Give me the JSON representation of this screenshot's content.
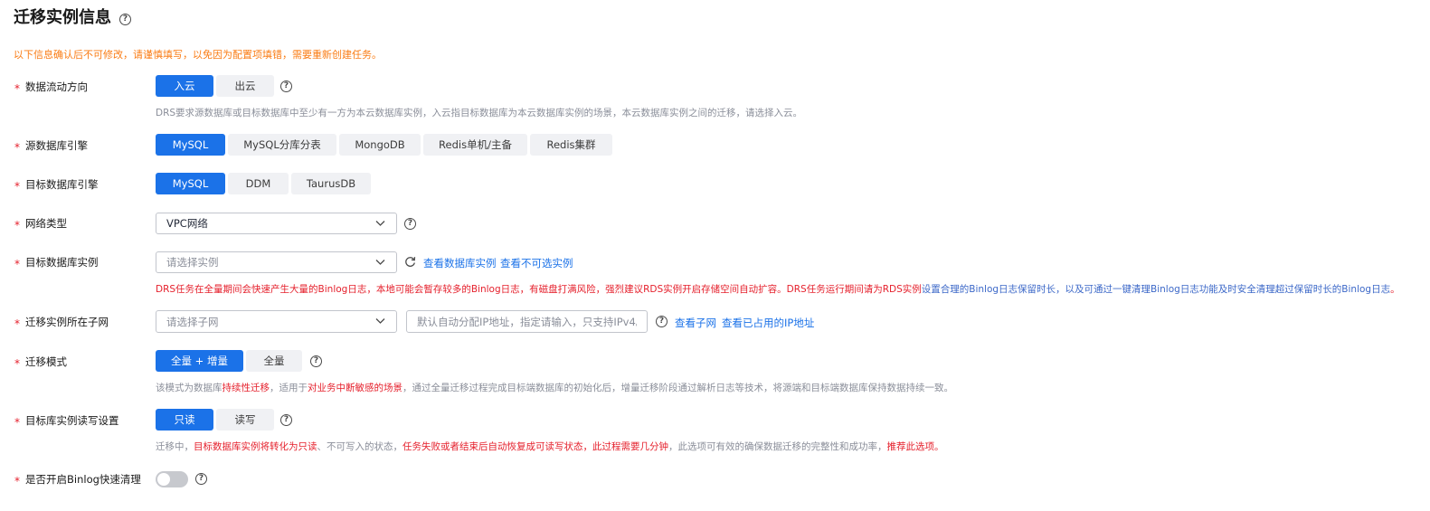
{
  "page": {
    "title": "迁移实例信息",
    "warning": "以下信息确认后不可修改，请谨慎填写，以免因为配置项填错，需要重新创建任务。"
  },
  "fields": {
    "flow": {
      "label": "数据流动方向",
      "options": [
        "入云",
        "出云"
      ],
      "selected": "入云",
      "hint": "DRS要求源数据库或目标数据库中至少有一方为本云数据库实例，入云指目标数据库为本云数据库实例的场景，本云数据库实例之间的迁移，请选择入云。"
    },
    "source_engine": {
      "label": "源数据库引擎",
      "options": [
        "MySQL",
        "MySQL分库分表",
        "MongoDB",
        "Redis单机/主备",
        "Redis集群"
      ],
      "selected": "MySQL"
    },
    "target_engine": {
      "label": "目标数据库引擎",
      "options": [
        "MySQL",
        "DDM",
        "TaurusDB"
      ],
      "selected": "MySQL"
    },
    "network": {
      "label": "网络类型",
      "value": "VPC网络"
    },
    "target_instance": {
      "label": "目标数据库实例",
      "placeholder": "请选择实例",
      "link_view": "查看数据库实例",
      "link_unavailable": "查看不可选实例",
      "warning_red_1": "DRS任务在全量期间会快速产生大量的Binlog日志，本地可能会暂存较多的Binlog日志，有磁盘打满风险，强烈建议RDS实例开启存储空间自动扩容。DRS任务运行期间请为RDS实例",
      "warning_blue": "设置合理的Binlog日志保留时长，以及可通过一键清理Binlog日志功能及时安全清理超过保留时长的Binlog日志",
      "warning_red_2": "。"
    },
    "subnet": {
      "label": "迁移实例所在子网",
      "placeholder": "请选择子网",
      "ip_placeholder": "默认自动分配IP地址，指定请输入，只支持IPv4。",
      "link_subnet": "查看子网",
      "link_used_ip": "查看已占用的IP地址"
    },
    "mode": {
      "label": "迁移模式",
      "options": [
        "全量 + 增量",
        "全量"
      ],
      "selected": "全量 + 增量",
      "hint_1": "该模式为数据库",
      "hint_2": "持续性迁移",
      "hint_3": "，适用于",
      "hint_4": "对业务中断敏感的场景",
      "hint_5": "，通过全量迁移过程完成目标端数据库的初始化后，增量迁移阶段通过解析日志等技术，将源端和目标端数据库保持数据持续一致。"
    },
    "readwrite": {
      "label": "目标库实例读写设置",
      "options": [
        "只读",
        "读写"
      ],
      "selected": "只读",
      "hint_1": "迁移中，",
      "hint_2": "目标数据库实例将转化为只读",
      "hint_3": "、不可写入的状态，",
      "hint_4": "任务失败或者结束后自动恢复成可读写状态，此过程需要几分钟",
      "hint_5": "，此选项可有效的确保数据迁移的完整性和成功率，",
      "hint_6": "推荐此选项。"
    },
    "binlog": {
      "label": "是否开启Binlog快速清理",
      "enabled": false
    }
  },
  "colors": {
    "primary": "#1b72e8",
    "required": "#e5202c",
    "warning_orange": "#fa7c14",
    "hint_gray": "#8a8e99"
  },
  "icons": {
    "help": "question-circle-icon",
    "dropdown": "chevron-down-icon",
    "refresh": "refresh-icon"
  }
}
